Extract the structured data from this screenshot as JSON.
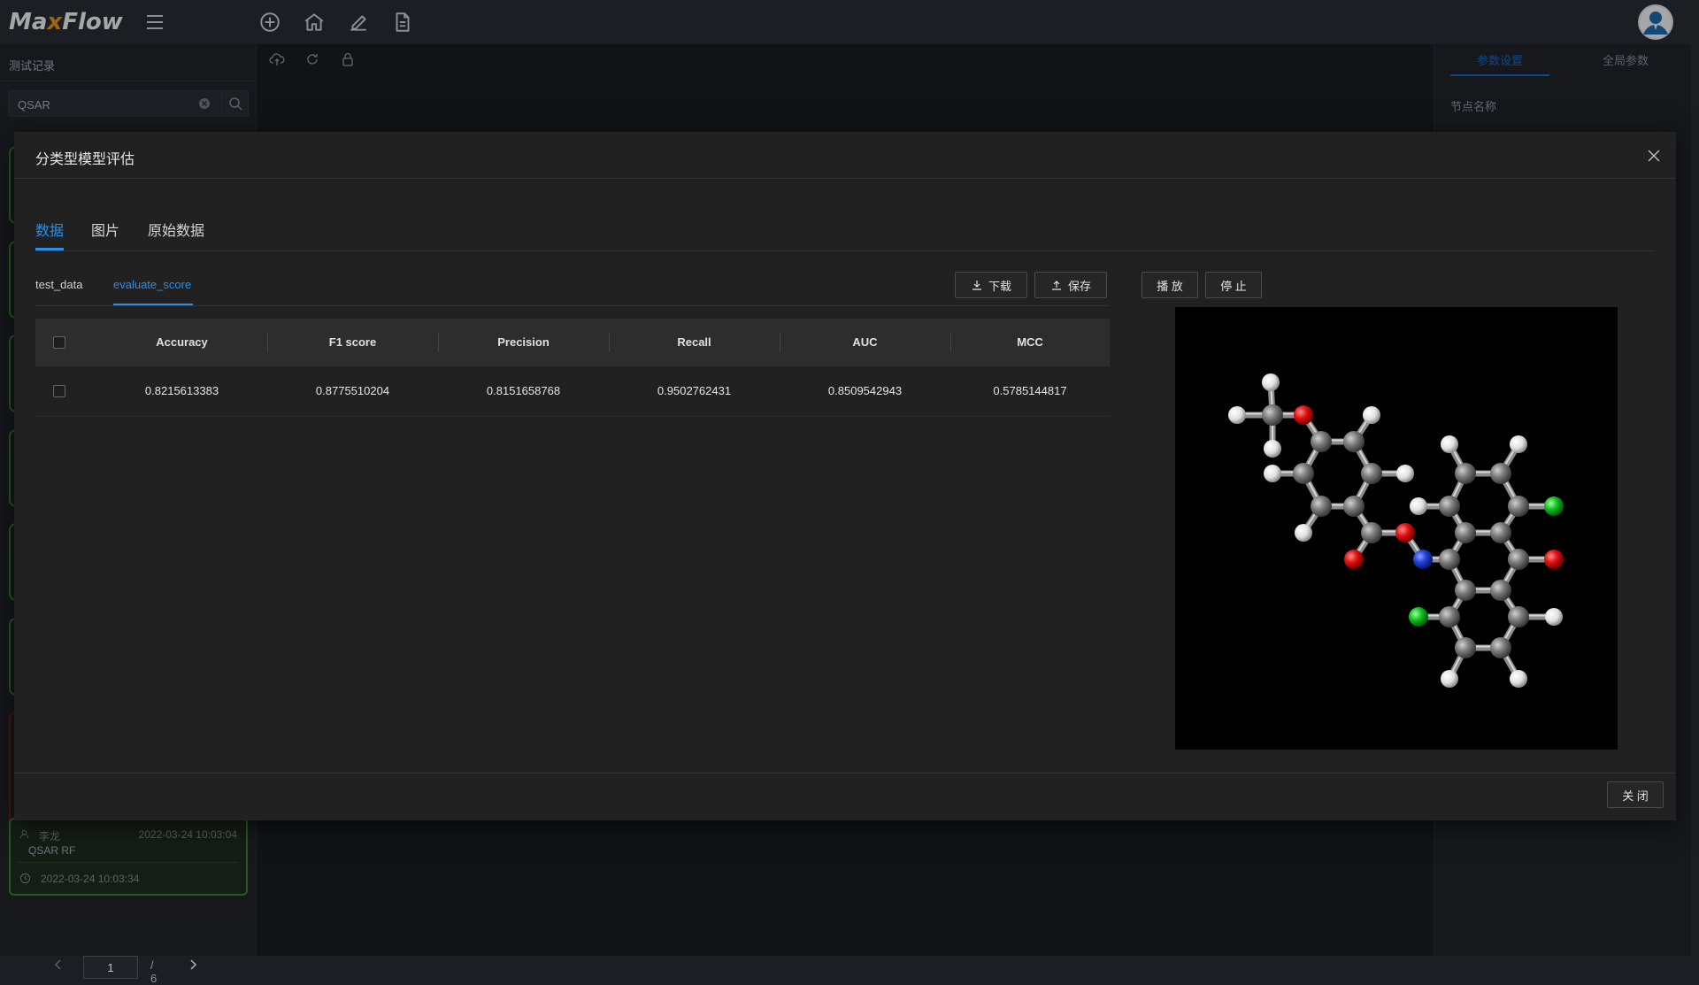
{
  "app": {
    "logo_prefix": "Ma",
    "logo_x": "x",
    "logo_suffix": "Flow"
  },
  "left_panel": {
    "title": "测试记录",
    "search": {
      "value": "QSAR"
    },
    "card": {
      "user": "李龙",
      "created": "2022-03-24 10:03:04",
      "name": "QSAR RF",
      "finished": "2022-03-24 10:03:34"
    },
    "pagination": {
      "current": "1",
      "total": "/ 6"
    }
  },
  "right_panel": {
    "tab_params": "参数设置",
    "tab_global": "全局参数",
    "node_name_label": "节点名称"
  },
  "dialog": {
    "title": "分类型模型评估",
    "tabs": [
      "数据",
      "图片",
      "原始数据"
    ],
    "active_tab": 0,
    "subtabs": [
      "test_data",
      "evaluate_score"
    ],
    "active_subtab": 1,
    "buttons": {
      "download": "下载",
      "save": "保存",
      "play": "播 放",
      "stop": "停 止",
      "close": "关 闭"
    },
    "table": {
      "columns": [
        "Accuracy",
        "F1 score",
        "Precision",
        "Recall",
        "AUC",
        "MCC"
      ],
      "rows": [
        [
          "0.8215613383",
          "0.8775510204",
          "0.8151658768",
          "0.9502762431",
          "0.8509542943",
          "0.5785144817"
        ]
      ]
    }
  },
  "colors": {
    "accent": "#2b8ee8",
    "topbar": "#2a2f36",
    "dialog_bg": "#212121",
    "card_border": "#3d8a33",
    "carbon": "#7a7a7a",
    "hydrogen": "#e8e8e8",
    "oxygen": "#e01010",
    "nitrogen": "#2040d8",
    "chlorine": "#10c020"
  },
  "icons": [
    "menu-icon",
    "add-circle-icon",
    "home-icon",
    "edit-icon",
    "document-icon",
    "user-avatar-icon",
    "cloud-upload-icon",
    "refresh-icon",
    "lock-icon",
    "clear-icon",
    "search-icon",
    "close-icon",
    "download-icon",
    "upload-icon",
    "user-icon",
    "clock-icon"
  ]
}
